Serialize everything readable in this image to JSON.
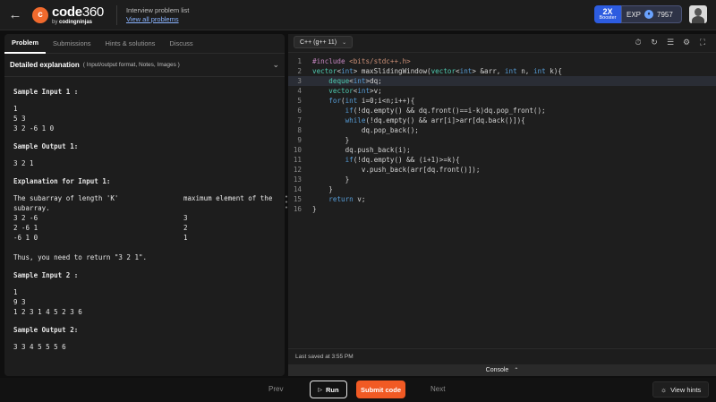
{
  "topbar": {
    "logo_main": "code",
    "logo_num": "360",
    "logo_sub_prefix": "by ",
    "logo_sub_brand": "codingninjas",
    "crumb_title": "Interview problem list",
    "crumb_link": "View all problems",
    "booster_value": "2X",
    "booster_label": "Booster",
    "exp_label": "EXP",
    "exp_value": "7957"
  },
  "left": {
    "tabs": [
      "Problem",
      "Submissions",
      "Hints & solutions",
      "Discuss"
    ],
    "detail_title": "Detailed explanation",
    "detail_sub": "( Input/output format, Notes, Images )",
    "sample_input_1_title": "Sample Input 1 :",
    "sample_input_1": [
      "1",
      "5 3",
      "3 2 -6 1 0"
    ],
    "sample_output_1_title": "Sample Output 1:",
    "sample_output_1": [
      "3 2 1"
    ],
    "explanation_title": "Explanation for Input 1:",
    "explanation_header_left": "The subarray of length 'K'",
    "explanation_header_right": "maximum element of the",
    "explanation_header_cont": "subarray.",
    "explanation_rows": [
      {
        "sub": "3 2 -6",
        "max": "3"
      },
      {
        "sub": "2 -6 1",
        "max": "2"
      },
      {
        "sub": "-6 1 0",
        "max": "1"
      }
    ],
    "explanation_conclusion": "Thus, you need to return \"3 2 1\".",
    "sample_input_2_title": "Sample Input 2 :",
    "sample_input_2": [
      "1",
      "9 3",
      "1 2 3 1 4 5 2 3 6"
    ],
    "sample_output_2_title": "Sample Output 2:",
    "sample_output_2": [
      "3 3 4 5 5 5 6"
    ]
  },
  "editor": {
    "language": "C++ (g++ 11)",
    "tool_icons": [
      "timer-icon",
      "refresh-icon",
      "list-icon",
      "settings-icon",
      "expand-icon"
    ],
    "code_lines": [
      "#include <bits/stdc++.h>",
      "vector<int> maxSlidingWindow(vector<int> &arr, int n, int k){",
      "    deque<int>dq;",
      "    vector<int>v;",
      "    for(int i=0;i<n;i++){",
      "        if(!dq.empty() && dq.front()==i-k)dq.pop_front();",
      "        while(!dq.empty() && arr[i]>arr[dq.back()]){",
      "            dq.pop_back();",
      "        }",
      "        dq.push_back(i);",
      "        if(!dq.empty() && (i+1)>=k){",
      "            v.push_back(arr[dq.front()]);",
      "        }",
      "    }",
      "    return v;",
      "}"
    ],
    "last_saved": "Last saved at 3:55 PM",
    "console_label": "Console"
  },
  "bottombar": {
    "prev": "Prev",
    "run": "Run",
    "submit": "Submit code",
    "next": "Next",
    "view_hints": "View hints"
  },
  "colors": {
    "accent": "#f15a24",
    "booster": "#2d5ce0",
    "link": "#8ab4ff"
  }
}
